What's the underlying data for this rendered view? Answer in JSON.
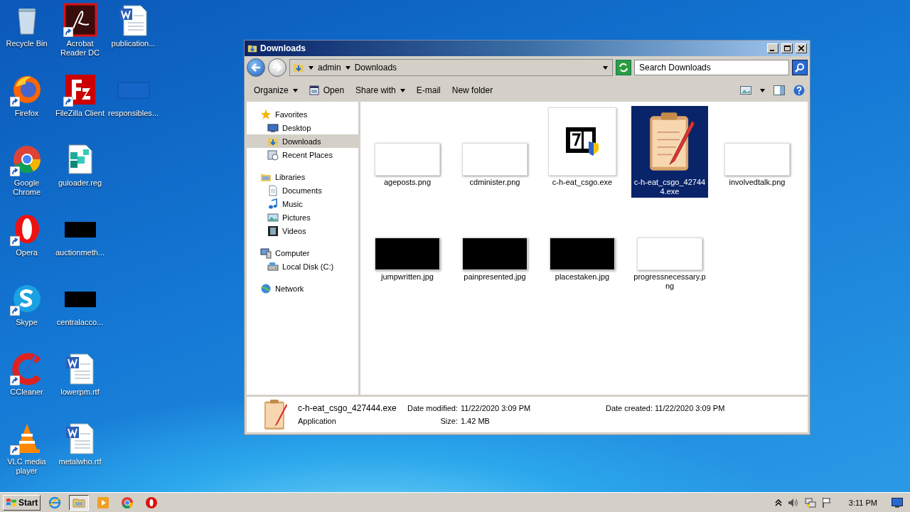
{
  "desktop_icons": [
    {
      "label": "Recycle Bin",
      "kind": "recycle",
      "shortcut": false
    },
    {
      "label": "Firefox",
      "kind": "firefox",
      "shortcut": true
    },
    {
      "label": "Google Chrome",
      "kind": "chrome",
      "shortcut": true
    },
    {
      "label": "Opera",
      "kind": "opera",
      "shortcut": true
    },
    {
      "label": "Skype",
      "kind": "skype",
      "shortcut": true
    },
    {
      "label": "CCleaner",
      "kind": "ccleaner",
      "shortcut": true
    },
    {
      "label": "VLC media player",
      "kind": "vlc",
      "shortcut": true
    },
    {
      "label": "Acrobat Reader DC",
      "kind": "pdf",
      "shortcut": true
    },
    {
      "label": "FileZilla Client",
      "kind": "filezilla",
      "shortcut": true
    },
    {
      "label": "guloader.reg",
      "kind": "reg",
      "shortcut": false
    },
    {
      "label": "auctionmeth...",
      "kind": "dark",
      "shortcut": false
    },
    {
      "label": "centralacco...",
      "kind": "dark",
      "shortcut": false
    },
    {
      "label": "lowerpm.rtf",
      "kind": "word",
      "shortcut": false
    },
    {
      "label": "metalwho.rtf",
      "kind": "word",
      "shortcut": false
    },
    {
      "label": "publication...",
      "kind": "word",
      "shortcut": false
    },
    {
      "label": "responsibles...",
      "kind": "bluedoc",
      "shortcut": false
    }
  ],
  "window": {
    "title": "Downloads",
    "address": [
      "admin",
      "Downloads"
    ],
    "search": {
      "placeholder": "Search Downloads"
    },
    "commands": [
      {
        "label": "Organize",
        "dropdown": true,
        "icon": false
      },
      {
        "label": "Open",
        "dropdown": false,
        "icon": true
      },
      {
        "label": "Share with",
        "dropdown": true,
        "icon": false
      },
      {
        "label": "E-mail",
        "dropdown": false,
        "icon": false
      },
      {
        "label": "New folder",
        "dropdown": false,
        "icon": false
      }
    ],
    "nav": [
      {
        "label": "Favorites",
        "kind": "star",
        "selected": false,
        "children": [
          {
            "label": "Desktop",
            "kind": "desktop",
            "selected": false
          },
          {
            "label": "Downloads",
            "kind": "downloads",
            "selected": true
          },
          {
            "label": "Recent Places",
            "kind": "recent",
            "selected": false
          }
        ]
      },
      {
        "label": "Libraries",
        "kind": "library",
        "selected": false,
        "children": [
          {
            "label": "Documents",
            "kind": "documents",
            "selected": false
          },
          {
            "label": "Music",
            "kind": "music",
            "selected": false
          },
          {
            "label": "Pictures",
            "kind": "pictures",
            "selected": false
          },
          {
            "label": "Videos",
            "kind": "videos",
            "selected": false
          }
        ]
      },
      {
        "label": "Computer",
        "kind": "computer",
        "selected": false,
        "children": [
          {
            "label": "Local Disk (C:)",
            "kind": "disk",
            "selected": false
          }
        ]
      },
      {
        "label": "Network",
        "kind": "network",
        "selected": false
      }
    ],
    "files": [
      {
        "name": "ageposts.png",
        "kind": "white",
        "selected": false
      },
      {
        "name": "cdminister.png",
        "kind": "white",
        "selected": false
      },
      {
        "name": "c-h-eat_csgo.exe",
        "kind": "setup",
        "selected": false
      },
      {
        "name": "c-h-eat_csgo_427444.exe",
        "kind": "notepad",
        "selected": true
      },
      {
        "name": "involvedtalk.png",
        "kind": "white",
        "selected": false
      },
      {
        "name": "jumpwritten.jpg",
        "kind": "black",
        "selected": false
      },
      {
        "name": "painpresented.jpg",
        "kind": "black",
        "selected": false
      },
      {
        "name": "placestaken.jpg",
        "kind": "black",
        "selected": false
      },
      {
        "name": "progressnecessary.png",
        "kind": "white",
        "selected": false
      }
    ],
    "details": {
      "name": "c-h-eat_csgo_427444.exe",
      "type": "Application",
      "fields": [
        {
          "label": "Date modified:",
          "value": "11/22/2020 3:09 PM"
        },
        {
          "label": "Size:",
          "value": "1.42 MB"
        },
        {
          "label": "Date created:",
          "value": "11/22/2020 3:09 PM"
        }
      ]
    }
  },
  "taskbar": {
    "start": "Start",
    "apps": [
      {
        "kind": "ie",
        "active": false
      },
      {
        "kind": "explorer",
        "active": true
      },
      {
        "kind": "media",
        "active": false
      },
      {
        "kind": "chrome",
        "active": false
      },
      {
        "kind": "opera",
        "active": false
      }
    ],
    "clock": "3:11 PM"
  }
}
